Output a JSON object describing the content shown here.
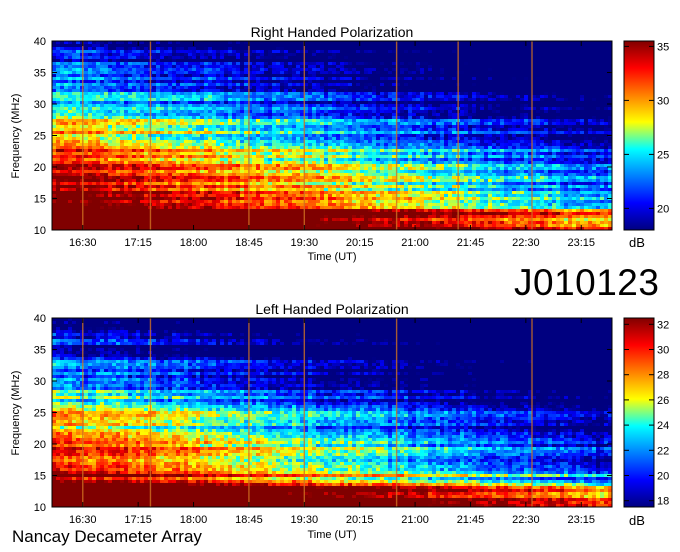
{
  "observation_id": "J010123",
  "credit": "Nancay Decameter Array",
  "colormap": [
    "#000080",
    "#0000ff",
    "#0080ff",
    "#00ffff",
    "#ffff00",
    "#ff8000",
    "#ff0000",
    "#800000"
  ],
  "chart_data": [
    {
      "type": "heatmap",
      "title": "Right Handed Polarization",
      "xlabel": "Time (UT)",
      "ylabel": "Frequency (MHz)",
      "xticks": [
        "16:30",
        "17:15",
        "18:00",
        "18:45",
        "19:30",
        "20:15",
        "21:00",
        "21:45",
        "22:30",
        "23:15"
      ],
      "xlim": [
        "16:05",
        "23:40"
      ],
      "yticks": [
        10,
        15,
        20,
        25,
        30,
        35,
        40
      ],
      "ylim": [
        10,
        40
      ],
      "colorbar": {
        "label": "dB",
        "range": [
          18,
          35.5
        ],
        "ticks": [
          20,
          25,
          30,
          35
        ]
      },
      "vertical_lines": [
        "16:30",
        "17:25",
        "18:45",
        "19:30",
        "20:45",
        "21:35",
        "22:35"
      ]
    },
    {
      "type": "heatmap",
      "title": "Left Handed Polarization",
      "xlabel": "Time (UT)",
      "ylabel": "Frequency (MHz)",
      "xticks": [
        "16:30",
        "17:15",
        "18:00",
        "18:45",
        "19:30",
        "20:15",
        "21:00",
        "21:45",
        "22:30",
        "23:15"
      ],
      "xlim": [
        "16:05",
        "23:40"
      ],
      "yticks": [
        10,
        15,
        20,
        25,
        30,
        35,
        40
      ],
      "ylim": [
        10,
        40
      ],
      "colorbar": {
        "label": "dB",
        "range": [
          17.5,
          32.5
        ],
        "ticks": [
          18,
          20,
          22,
          24,
          26,
          28,
          30,
          32
        ]
      },
      "vertical_lines": [
        "16:30",
        "17:25",
        "18:45",
        "19:30",
        "20:45",
        "22:35"
      ]
    }
  ]
}
